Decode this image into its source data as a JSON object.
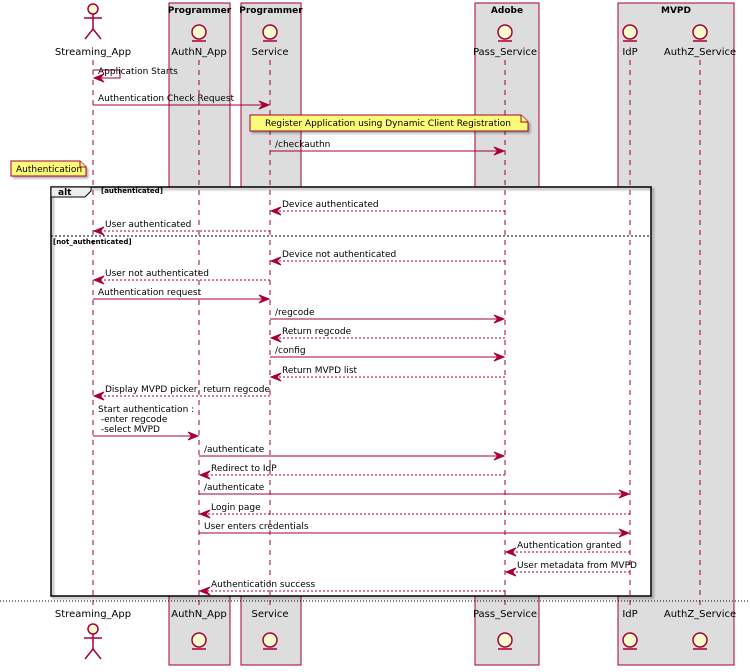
{
  "colors": {
    "accent": "#a80036",
    "box_fill": "#dddddd",
    "participant_fill": "#fefece",
    "note_fill": "#fbfb77"
  },
  "boxes": [
    {
      "id": "programmer1",
      "title": "Programmer"
    },
    {
      "id": "programmer2",
      "title": "Programmer"
    },
    {
      "id": "adobe",
      "title": "Adobe"
    },
    {
      "id": "mvpd",
      "title": "MVPD"
    }
  ],
  "participants": [
    {
      "id": "streaming_app",
      "name": "Streaming_App",
      "kind": "actor",
      "icon": "actor-icon"
    },
    {
      "id": "authn_app",
      "name": "AuthN_App",
      "kind": "entity",
      "icon": "entity-icon"
    },
    {
      "id": "service",
      "name": "Service",
      "kind": "entity",
      "icon": "entity-icon"
    },
    {
      "id": "pass_service",
      "name": "Pass_Service",
      "kind": "entity",
      "icon": "entity-icon"
    },
    {
      "id": "idp",
      "name": "IdP",
      "kind": "entity",
      "icon": "entity-icon"
    },
    {
      "id": "authz_service",
      "name": "AuthZ_Service",
      "kind": "entity",
      "icon": "entity-icon"
    }
  ],
  "notes": [
    {
      "id": "register-note",
      "text": "Register Application using Dynamic Client Registration"
    },
    {
      "id": "authentication-note",
      "text": "Authentication"
    }
  ],
  "alt": {
    "label": "alt",
    "guards": [
      "[authenticated]",
      "[not_authenticated]"
    ]
  },
  "messages": [
    {
      "from": "streaming_app",
      "to": "streaming_app",
      "style": "solid",
      "lines": [
        "Application Starts"
      ]
    },
    {
      "from": "streaming_app",
      "to": "service",
      "style": "solid",
      "lines": [
        "Authentication Check Request"
      ]
    },
    {
      "from": "service",
      "to": "pass_service",
      "style": "solid",
      "lines": [
        "/checkauthn"
      ]
    },
    {
      "from": "pass_service",
      "to": "service",
      "style": "dashed",
      "lines": [
        "Device authenticated"
      ]
    },
    {
      "from": "service",
      "to": "streaming_app",
      "style": "dashed",
      "lines": [
        "User authenticated"
      ]
    },
    {
      "from": "pass_service",
      "to": "service",
      "style": "dashed",
      "lines": [
        "Device not authenticated"
      ]
    },
    {
      "from": "service",
      "to": "streaming_app",
      "style": "dashed",
      "lines": [
        "User not authenticated"
      ]
    },
    {
      "from": "streaming_app",
      "to": "service",
      "style": "solid",
      "lines": [
        "Authentication request"
      ]
    },
    {
      "from": "service",
      "to": "pass_service",
      "style": "solid",
      "lines": [
        "/regcode"
      ]
    },
    {
      "from": "pass_service",
      "to": "service",
      "style": "dashed",
      "lines": [
        "Return regcode"
      ]
    },
    {
      "from": "service",
      "to": "pass_service",
      "style": "solid",
      "lines": [
        "/config"
      ]
    },
    {
      "from": "pass_service",
      "to": "service",
      "style": "dashed",
      "lines": [
        "Return MVPD list"
      ]
    },
    {
      "from": "service",
      "to": "streaming_app",
      "style": "dashed",
      "lines": [
        "Display MVPD picker, return regcode"
      ]
    },
    {
      "from": "streaming_app",
      "to": "authn_app",
      "style": "solid",
      "lines": [
        "Start authentication :",
        " -enter regcode",
        " -select MVPD"
      ]
    },
    {
      "from": "authn_app",
      "to": "pass_service",
      "style": "solid",
      "lines": [
        "/authenticate"
      ]
    },
    {
      "from": "pass_service",
      "to": "authn_app",
      "style": "dashed",
      "lines": [
        "Redirect to IdP"
      ]
    },
    {
      "from": "authn_app",
      "to": "idp",
      "style": "solid",
      "lines": [
        "/authenticate"
      ]
    },
    {
      "from": "idp",
      "to": "authn_app",
      "style": "dashed",
      "lines": [
        "Login page"
      ]
    },
    {
      "from": "authn_app",
      "to": "idp",
      "style": "solid",
      "lines": [
        "User enters credentials"
      ]
    },
    {
      "from": "idp",
      "to": "pass_service",
      "style": "dashed",
      "lines": [
        "Authentication granted"
      ]
    },
    {
      "from": "idp",
      "to": "pass_service",
      "style": "dashed",
      "lines": [
        "User metadata from MVPD"
      ]
    },
    {
      "from": "pass_service",
      "to": "authn_app",
      "style": "dashed",
      "lines": [
        "Authentication success"
      ]
    }
  ]
}
